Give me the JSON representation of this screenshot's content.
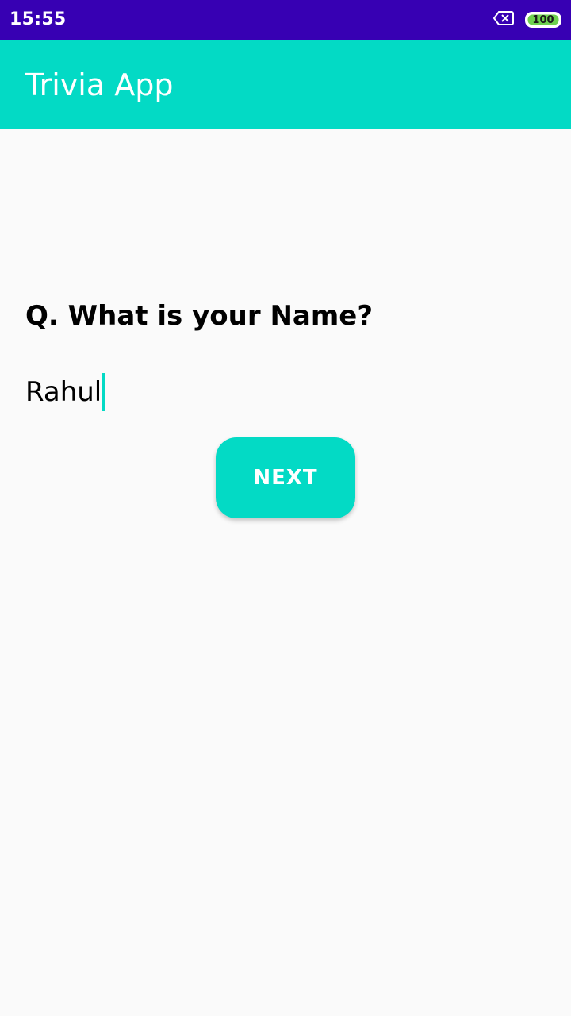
{
  "status_bar": {
    "time": "15:55",
    "battery_level": "100",
    "icons": [
      "sim-off-icon",
      "battery-icon"
    ],
    "background": "#3700b3"
  },
  "app_bar": {
    "title": "Trivia App",
    "background": "#03dac5"
  },
  "main": {
    "question": "Q. What is your Name?",
    "answer_value": "Rahul",
    "next_button_label": "NEXT",
    "accent": "#03dac5",
    "background": "#fafafa"
  }
}
